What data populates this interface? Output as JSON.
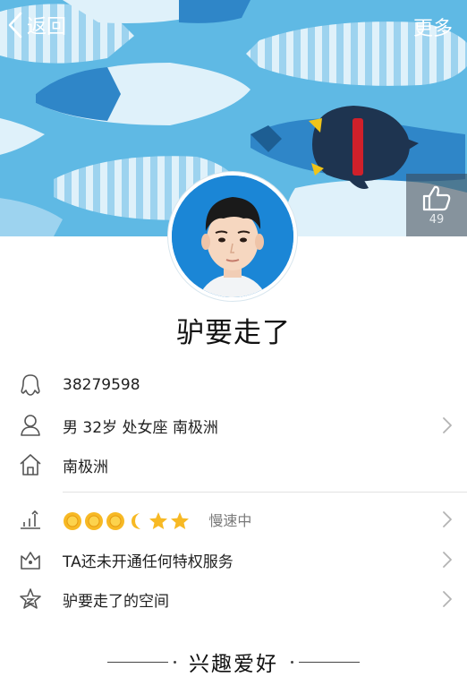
{
  "header": {
    "back_label": "返回",
    "more_label": "更多",
    "like_count": "49"
  },
  "profile": {
    "nickname": "驴要走了"
  },
  "info": {
    "qq_number": "38279598",
    "basic": "男 32岁 处女座 南极洲",
    "location": "南极洲",
    "level_icons": [
      "sun-icon",
      "sun-icon",
      "sun-icon",
      "moon-icon",
      "star-icon",
      "star-icon"
    ],
    "speed": "慢速中",
    "privilege": "TA还未开通任何特权服务",
    "space": "驴要走了的空间"
  },
  "section": {
    "interests_title": "兴趣爱好"
  },
  "colors": {
    "banner": "#5fb9e4",
    "fish_light": "#dff1fa",
    "fish_mid": "#2f86c8",
    "penguin": "#1e3450",
    "penguin_scarf": "#d0202a"
  }
}
